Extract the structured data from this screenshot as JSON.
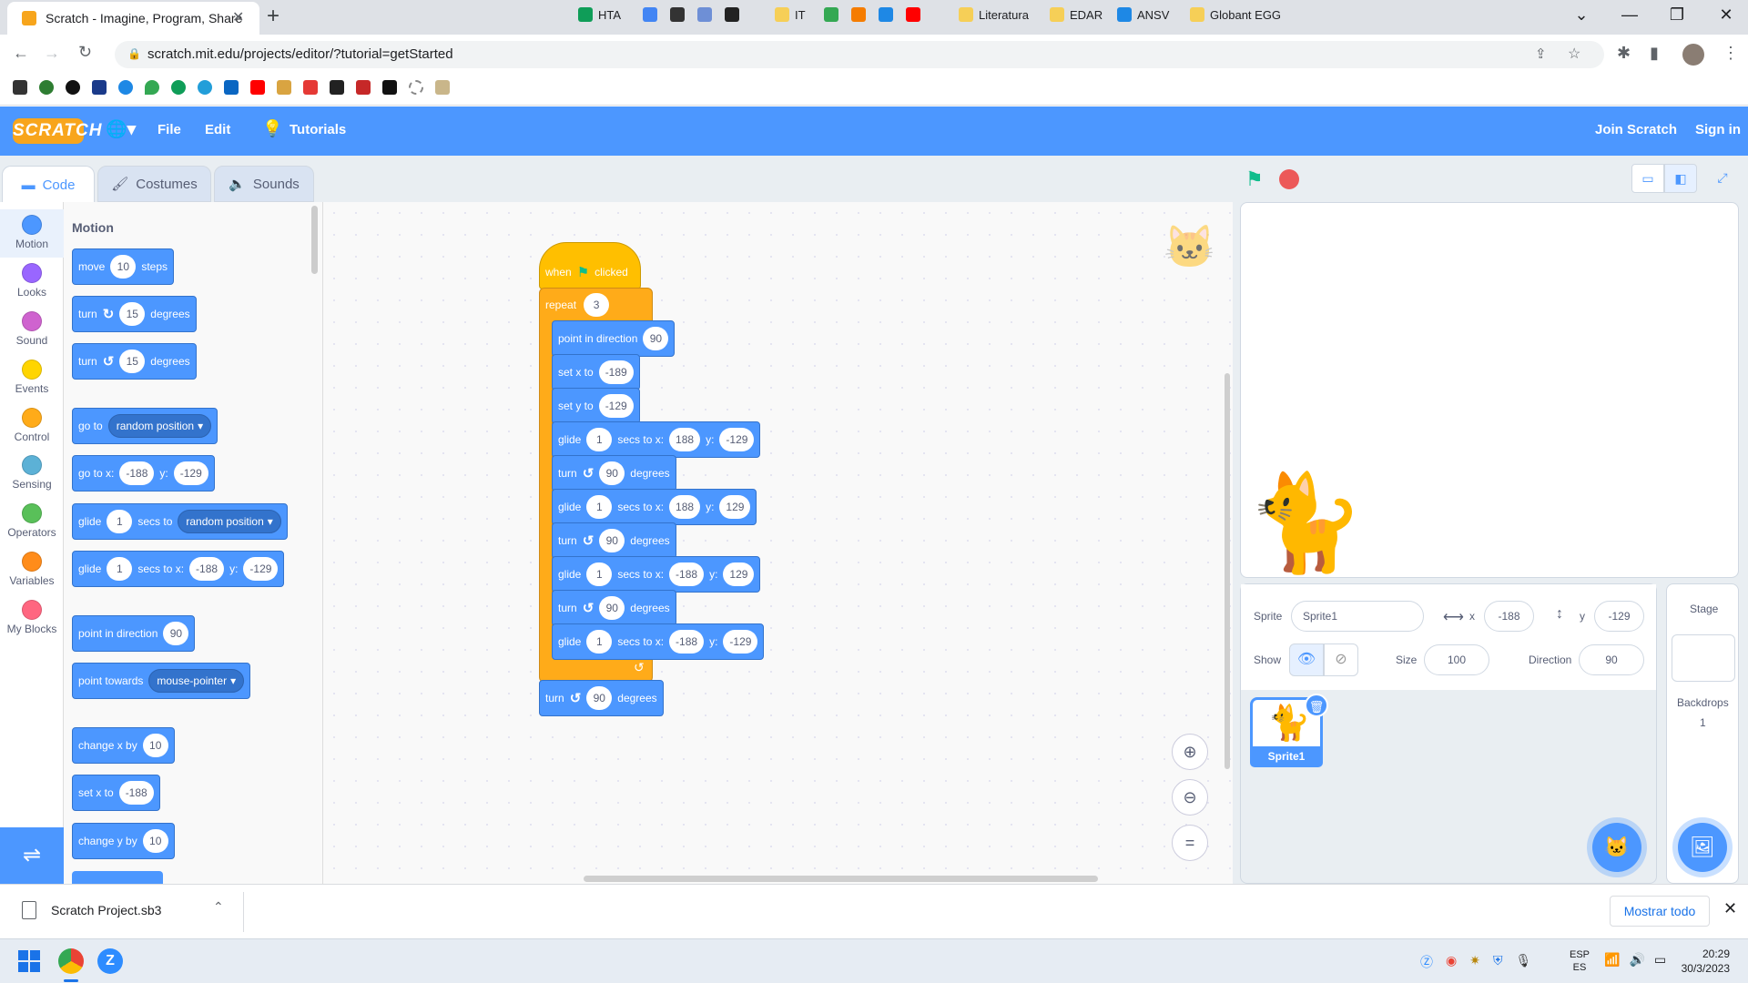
{
  "browser": {
    "tab_title": "Scratch - Imagine, Program, Share",
    "url": "scratch.mit.edu/projects/editor/?tutorial=getStarted",
    "bookmarks": [
      "HTA",
      "IT",
      "Literatura",
      "EDAR",
      "ANSV",
      "Globant EGG"
    ]
  },
  "menubar": {
    "logo": "SCRATCH",
    "file": "File",
    "edit": "Edit",
    "tutorials": "Tutorials",
    "join": "Join Scratch",
    "signin": "Sign in"
  },
  "tabs": {
    "code": "Code",
    "costumes": "Costumes",
    "sounds": "Sounds"
  },
  "categories": [
    {
      "label": "Motion",
      "color": "#4c97ff"
    },
    {
      "label": "Looks",
      "color": "#9966ff"
    },
    {
      "label": "Sound",
      "color": "#cf63cf"
    },
    {
      "label": "Events",
      "color": "#ffd500"
    },
    {
      "label": "Control",
      "color": "#ffab19"
    },
    {
      "label": "Sensing",
      "color": "#5cb1d6"
    },
    {
      "label": "Operators",
      "color": "#59c059"
    },
    {
      "label": "Variables",
      "color": "#ff8c1a"
    },
    {
      "label": "My Blocks",
      "color": "#ff6680"
    }
  ],
  "palette": {
    "title": "Motion",
    "move": "move",
    "move_val": "10",
    "steps": "steps",
    "turn": "turn",
    "turn_r_val": "15",
    "turn_l_val": "15",
    "degrees": "degrees",
    "go_to": "go to",
    "random_position": "random position",
    "go_to_x": "go to x:",
    "goto_x_val": "-188",
    "y": "y:",
    "goto_y_val": "-129",
    "glide": "glide",
    "glide_val": "1",
    "secs_to": "secs to",
    "secs_to_x": "secs to x:",
    "glide_x_val": "-188",
    "glide_y_val": "-129",
    "point_in_direction": "point in direction",
    "direction_val": "90",
    "point_towards": "point towards",
    "mouse_pointer": "mouse-pointer",
    "change_x_by": "change x by",
    "change_x_val": "10",
    "set_x_to": "set x to",
    "set_x_val": "-188",
    "change_y_by": "change y by",
    "change_y_val": "10"
  },
  "script": {
    "when": "when",
    "clicked": "clicked",
    "repeat": "repeat",
    "repeat_val": "3",
    "point_in_direction": "point in direction",
    "dir_val": "90",
    "set_x_to": "set x to",
    "set_x_val": "-189",
    "set_y_to": "set y to",
    "set_y_val": "-129",
    "glide": "glide",
    "secs_to_x": "secs to x:",
    "y": "y:",
    "g1": [
      "1",
      "188",
      "-129"
    ],
    "g2": [
      "1",
      "188",
      "129"
    ],
    "g3": [
      "1",
      "-188",
      "129"
    ],
    "g4": [
      "1",
      "-188",
      "-129"
    ],
    "turn": "turn",
    "turn_val": "90",
    "degrees": "degrees"
  },
  "sprite_info": {
    "sprite_label": "Sprite",
    "sprite_name": "Sprite1",
    "x_label": "x",
    "x_val": "-188",
    "y_label": "y",
    "y_val": "-129",
    "show_label": "Show",
    "size_label": "Size",
    "size_val": "100",
    "direction_label": "Direction",
    "direction_val": "90",
    "thumb_name": "Sprite1"
  },
  "stage_panel": {
    "title": "Stage",
    "backdrops_label": "Backdrops",
    "backdrops_count": "1"
  },
  "download": {
    "file": "Scratch Project.sb3",
    "show_all": "Mostrar todo"
  },
  "taskbar": {
    "lang1": "ESP",
    "lang2": "ES",
    "time": "20:29",
    "date": "30/3/2023"
  }
}
